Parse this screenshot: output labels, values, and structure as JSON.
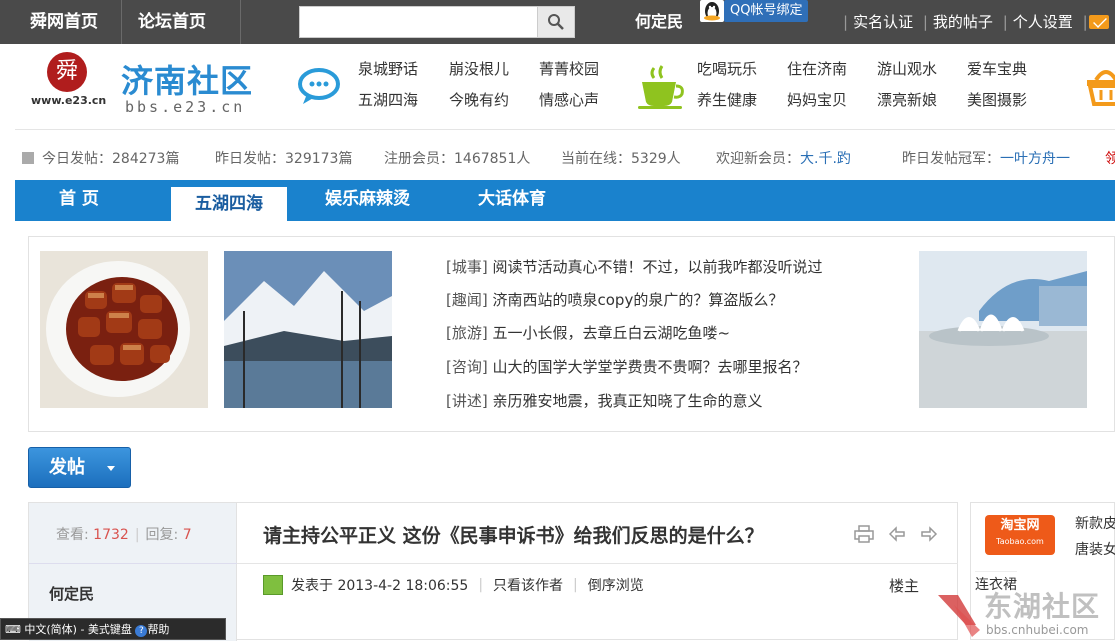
{
  "topbar": {
    "home": "舜网首页",
    "forum_home": "论坛首页",
    "username": "何定民",
    "qq_bind": "QQ帐号绑定",
    "links": [
      "实名认证",
      "我的帖子",
      "个人设置"
    ]
  },
  "header": {
    "logo_char": "舜",
    "logo_www": "www.e23.cn",
    "site_name": "济南社区",
    "site_url": "bbs.e23.cn",
    "links_group1": [
      "泉城野话",
      "崩没根儿",
      "菁菁校园",
      "五湖四海",
      "今晚有约",
      "情感心声"
    ],
    "links_group2": [
      "吃喝玩乐",
      "住在济南",
      "游山观水",
      "爱车宝典",
      "养生健康",
      "妈妈宝贝",
      "漂亮新娘",
      "美图摄影"
    ]
  },
  "stats": {
    "today": "今日发帖：284273篇",
    "yesterday": "昨日发帖：329173篇",
    "members": "注册会员：1467851人",
    "online": "当前在线：5329人",
    "newmember_label": "欢迎新会员：",
    "newmember": "大.千.趵",
    "champion_label": "昨日发帖冠军：",
    "champion": "一叶方舟一",
    "trailing": "领"
  },
  "tabs": [
    "首 页",
    "五湖四海",
    "娱乐麻辣烫",
    "大话体育"
  ],
  "news": [
    {
      "cat": "[城事]",
      "text": "阅读节活动真心不错！不过，以前我咋都没听说过"
    },
    {
      "cat": "[趣闻]",
      "text": "济南西站的喷泉copy的泉广的？算盗版么？"
    },
    {
      "cat": "[旅游]",
      "text": "五一小长假，去章丘白云湖吃鱼喽~"
    },
    {
      "cat": "[咨询]",
      "text": "山大的国学大学堂学费贵不贵啊？去哪里报名？"
    },
    {
      "cat": "[讲述]",
      "text": "亲历雅安地震，我真正知晓了生命的意义"
    }
  ],
  "post_button": "发帖",
  "thread": {
    "views_label": "查看:",
    "views": "1732",
    "replies_label": "回复:",
    "replies": "7",
    "author": "何定民",
    "title": "请主持公平正义 这份《民事申诉书》给我们反思的是什么？",
    "posted": "发表于 2013-4-2 18:06:55",
    "only_author": "只看该作者",
    "reverse": "倒序浏览",
    "floor": "楼主"
  },
  "ad": {
    "logo": "淘宝网",
    "logo_sub": "Taobao.com",
    "line1": "新款皮",
    "line2": "唐装女",
    "item": "连衣裙"
  },
  "watermark": {
    "text": "东湖社区",
    "url": "bbs.cnhubei.com"
  },
  "ime": "中文(简体) - 美式键盘",
  "help": "帮助",
  "colors": {
    "accent": "#1a82cd",
    "topbar": "#4a4a4a",
    "taobao": "#ee5a19"
  }
}
